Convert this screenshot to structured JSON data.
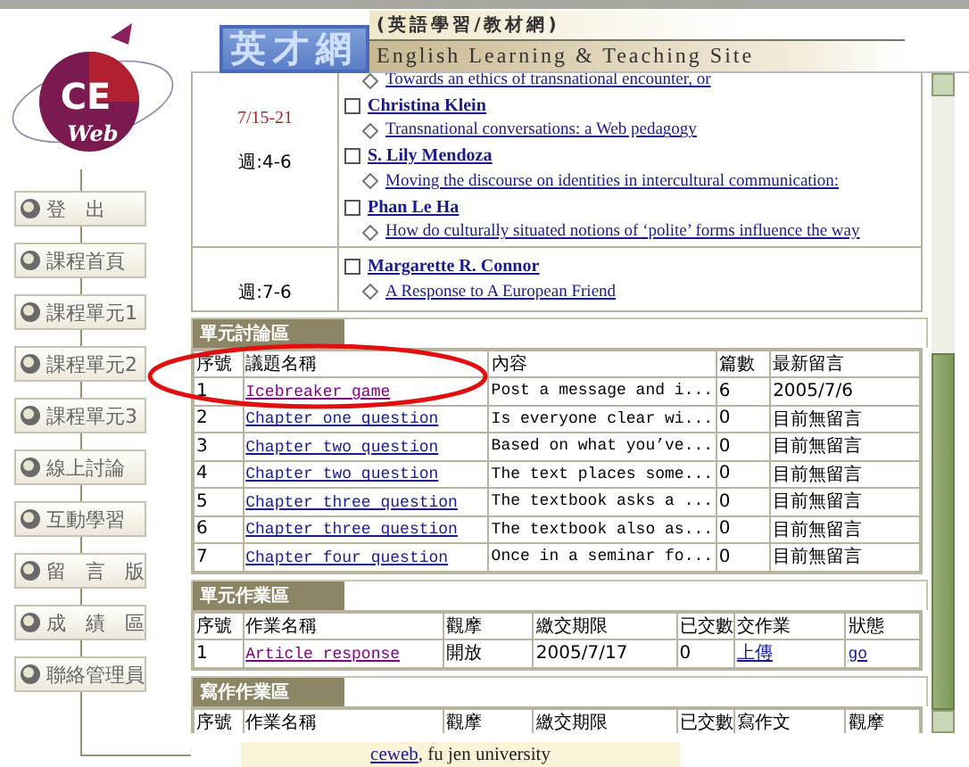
{
  "logo": {
    "text": "CE",
    "subtext": "Web"
  },
  "nav": [
    {
      "label": "登　出"
    },
    {
      "label": "課程首頁"
    },
    {
      "label": "課程單元1"
    },
    {
      "label": "課程單元2"
    },
    {
      "label": "課程單元3"
    },
    {
      "label": "線上討論"
    },
    {
      "label": "互動學習"
    },
    {
      "label": "留　言　版"
    },
    {
      "label": "成　績　區"
    },
    {
      "label": "聯絡管理員"
    }
  ],
  "header": {
    "title": "英才網",
    "subtitle": "(英語學習/教材網)",
    "tagline": "English Learning & Teaching Site"
  },
  "schedule": [
    {
      "date": "7/15-21",
      "week": "週:4-6",
      "entries": [
        {
          "kind": "article",
          "text": "Towards an ethics of transnational encounter, or"
        },
        {
          "kind": "author",
          "text": "Christina Klein"
        },
        {
          "kind": "article",
          "text": "Transnational conversations: a Web pedagogy"
        },
        {
          "kind": "author",
          "text": "S. Lily Mendoza"
        },
        {
          "kind": "article",
          "text": "Moving the discourse on identities in intercultural communication:"
        },
        {
          "kind": "author",
          "text": "Phan Le Ha"
        },
        {
          "kind": "article",
          "text": "How do culturally situated notions of ‘polite’ forms influence the way"
        }
      ]
    },
    {
      "week": "週:7-6",
      "entries": [
        {
          "kind": "author",
          "text": "Margarette R. Connor"
        },
        {
          "kind": "article",
          "text": "A Response to A European Friend"
        }
      ]
    }
  ],
  "discussion": {
    "title": "單元討論區",
    "columns": [
      "序號",
      "議題名稱",
      "內容",
      "篇數",
      "最新留言"
    ],
    "rows": [
      {
        "no": "1",
        "topic": "Icebreaker game",
        "visited": true,
        "content": "Post a message and i...",
        "count": "6",
        "latest": "2005/7/6"
      },
      {
        "no": "2",
        "topic": "Chapter one question",
        "visited": false,
        "content": "Is everyone clear wi...",
        "count": "0",
        "latest": "目前無留言"
      },
      {
        "no": "3",
        "topic": "Chapter two question",
        "visited": false,
        "content": "Based on what you’ve...",
        "count": "0",
        "latest": "目前無留言"
      },
      {
        "no": "4",
        "topic": "Chapter two question",
        "visited": false,
        "content": "The text places some...",
        "count": "0",
        "latest": "目前無留言"
      },
      {
        "no": "5",
        "topic": "Chapter three question",
        "visited": false,
        "content": "The textbook asks a ...",
        "count": "0",
        "latest": "目前無留言"
      },
      {
        "no": "6",
        "topic": "Chapter three question",
        "visited": false,
        "content": "The textbook also as...",
        "count": "0",
        "latest": "目前無留言"
      },
      {
        "no": "7",
        "topic": "Chapter four question",
        "visited": false,
        "content": "Once in a seminar fo...",
        "count": "0",
        "latest": "目前無留言"
      }
    ]
  },
  "assignments": {
    "title": "單元作業區",
    "columns": [
      "序號",
      "作業名稱",
      "觀摩",
      "繳交期限",
      "已交數",
      "交作業",
      "狀態"
    ],
    "rows": [
      {
        "no": "1",
        "name": "Article response",
        "visited": true,
        "observe": "開放",
        "deadline": "2005/7/17",
        "submitted": "0",
        "upload": "上傳",
        "status": "go"
      }
    ]
  },
  "writing": {
    "title": "寫作作業區",
    "columns": [
      "序號",
      "作業名稱",
      "觀摩",
      "繳交期限",
      "已交數",
      "寫作文",
      "觀摩"
    ]
  },
  "footer": {
    "link": "ceweb",
    "text": ", fu jen university"
  }
}
